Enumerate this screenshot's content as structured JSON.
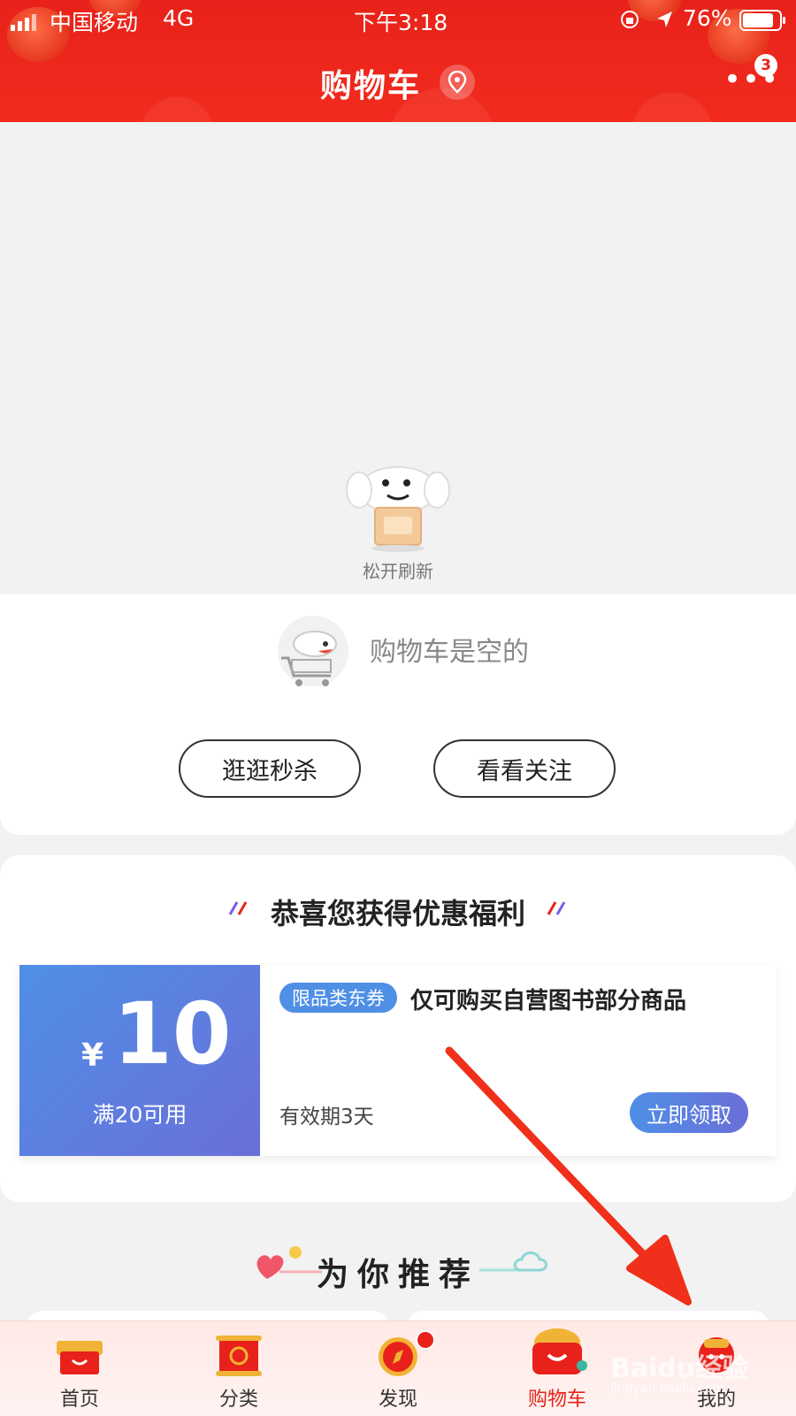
{
  "status_bar": {
    "carrier": "中国移动",
    "network": "4G",
    "time": "下午3:18",
    "battery": "76%"
  },
  "header": {
    "title": "购物车",
    "more_badge": "3"
  },
  "refresh": {
    "label": "松开刷新"
  },
  "empty_cart": {
    "message": "购物车是空的",
    "buttons": [
      "逛逛秒杀",
      "看看关注"
    ]
  },
  "benefit": {
    "title": "恭喜您获得优惠福利",
    "coupon": {
      "currency": "¥",
      "amount": "10",
      "condition": "满20可用",
      "tag": "限品类东券",
      "description": "仅可购买自营图书部分商品",
      "validity": "有效期3天",
      "claim_label": "立即领取"
    }
  },
  "recommend": {
    "title": "为你推荐"
  },
  "bottom_nav": {
    "items": [
      {
        "label": "首页",
        "icon": "home-icon"
      },
      {
        "label": "分类",
        "icon": "category-icon"
      },
      {
        "label": "发现",
        "icon": "discover-icon"
      },
      {
        "label": "购物车",
        "icon": "cart-icon"
      },
      {
        "label": "我的",
        "icon": "profile-icon"
      }
    ],
    "active_index": 3
  },
  "watermark": {
    "text": "Baidu经验",
    "url_text": "jingyan.baidu.com"
  },
  "colors": {
    "brand_red": "#e8221a",
    "coupon_blue": "#4f8fe6",
    "coupon_purple": "#6a6fd8",
    "arrow_red": "#f0301a"
  }
}
